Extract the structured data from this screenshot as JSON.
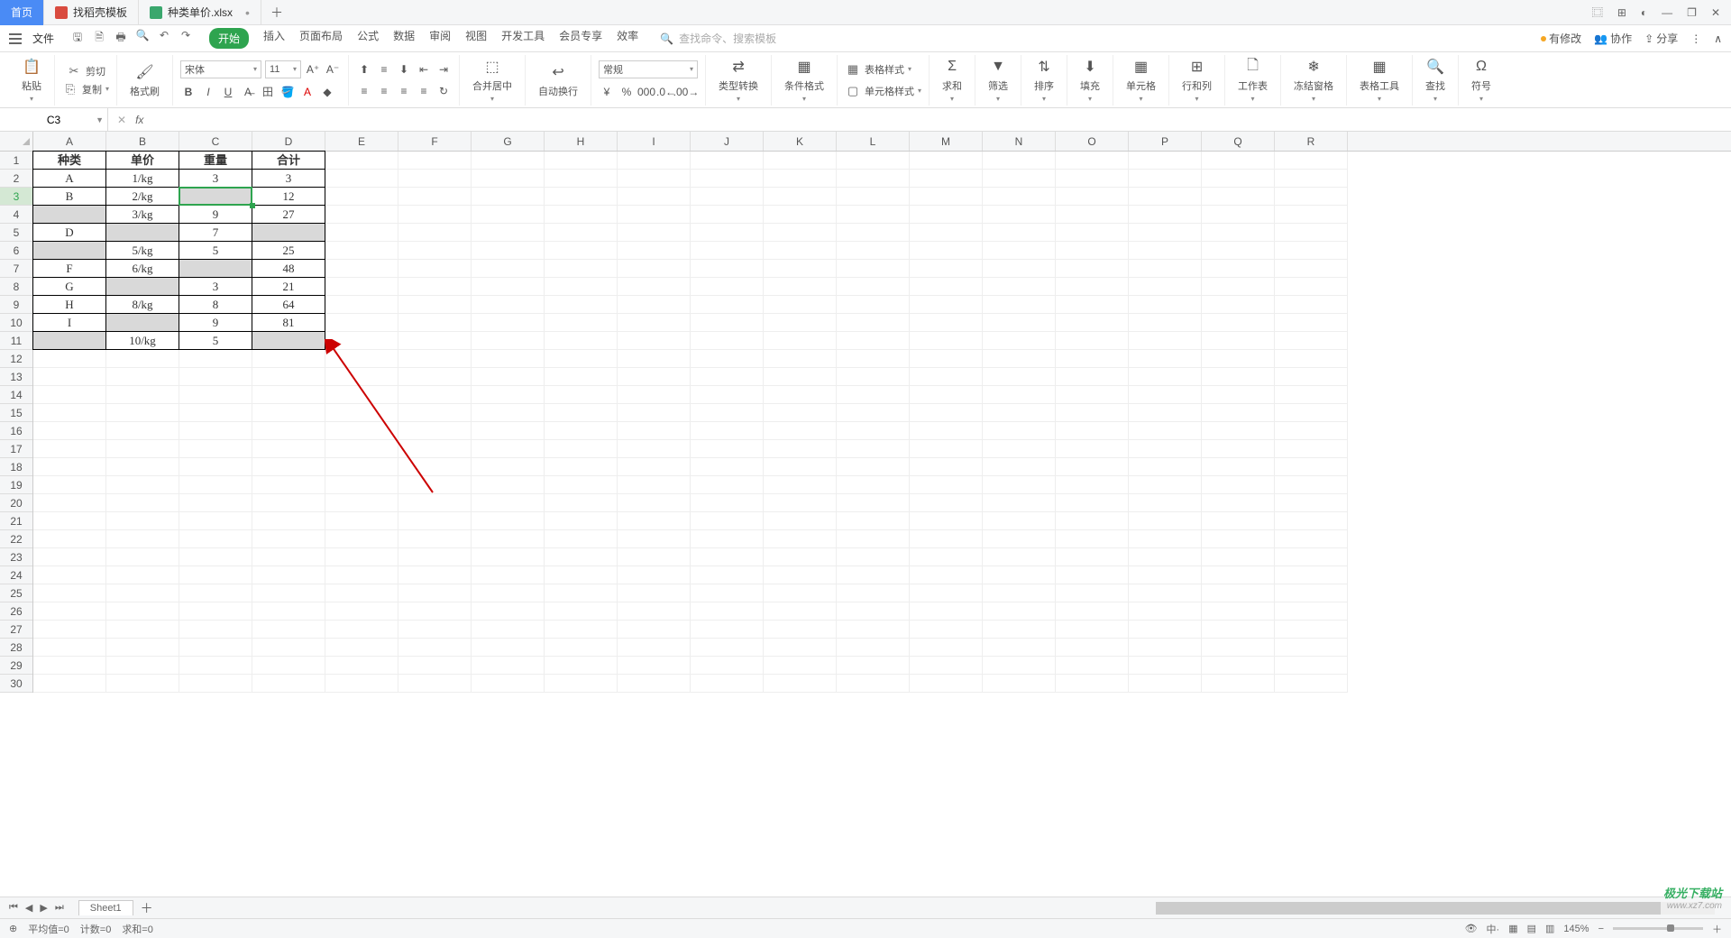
{
  "title_tabs": {
    "home": "首页",
    "template": "找稻壳模板",
    "file": "种类单价.xlsx"
  },
  "menu": {
    "file": "文件",
    "tabs": [
      "开始",
      "插入",
      "页面布局",
      "公式",
      "数据",
      "审阅",
      "视图",
      "开发工具",
      "会员专享",
      "效率"
    ],
    "search_placeholder": "查找命令、搜索模板",
    "right": {
      "unsaved": "有修改",
      "coop": "协作",
      "share": "分享"
    }
  },
  "ribbon": {
    "paste": "粘贴",
    "cut": "剪切",
    "copy": "复制",
    "format_painter": "格式刷",
    "font_name": "宋体",
    "font_size": "11",
    "merge": "合并居中",
    "wrap": "自动换行",
    "number_format": "常规",
    "type_convert": "类型转换",
    "cond_format": "条件格式",
    "table_style": "表格样式",
    "cell_style": "单元格样式",
    "sum": "求和",
    "filter": "筛选",
    "sort": "排序",
    "fill": "填充",
    "cells": "单元格",
    "rowcol": "行和列",
    "sheet": "工作表",
    "freeze": "冻结窗格",
    "table_tools": "表格工具",
    "find": "查找",
    "symbol": "符号"
  },
  "namebox": "C3",
  "columns": [
    "A",
    "B",
    "C",
    "D",
    "E",
    "F",
    "G",
    "H",
    "I",
    "J",
    "K",
    "L",
    "M",
    "N",
    "O",
    "P",
    "Q",
    "R"
  ],
  "row_count": 30,
  "selected_row": 3,
  "table": {
    "headers": [
      "种类",
      "单价",
      "重量",
      "合计"
    ],
    "rows": [
      {
        "a": "A",
        "b": "1/kg",
        "c": "3",
        "d": "3",
        "gray": []
      },
      {
        "a": "B",
        "b": "2/kg",
        "c": "",
        "d": "12",
        "gray": [
          "c"
        ]
      },
      {
        "a": "",
        "b": "3/kg",
        "c": "9",
        "d": "27",
        "gray": [
          "a"
        ]
      },
      {
        "a": "D",
        "b": "",
        "c": "7",
        "d": "",
        "gray": [
          "b",
          "d"
        ]
      },
      {
        "a": "",
        "b": "5/kg",
        "c": "5",
        "d": "25",
        "gray": [
          "a"
        ]
      },
      {
        "a": "F",
        "b": "6/kg",
        "c": "",
        "d": "48",
        "gray": [
          "c"
        ]
      },
      {
        "a": "G",
        "b": "",
        "c": "3",
        "d": "21",
        "gray": [
          "b"
        ]
      },
      {
        "a": "H",
        "b": "8/kg",
        "c": "8",
        "d": "64",
        "gray": []
      },
      {
        "a": "I",
        "b": "",
        "c": "9",
        "d": "81",
        "gray": [
          "b"
        ]
      },
      {
        "a": "",
        "b": "10/kg",
        "c": "5",
        "d": "",
        "gray": [
          "a",
          "d"
        ]
      }
    ]
  },
  "sheet": {
    "name": "Sheet1"
  },
  "status": {
    "avg": "平均值=0",
    "count": "计数=0",
    "sum": "求和=0",
    "zoom": "145%"
  },
  "watermark": {
    "brand": "极光下载站",
    "site": "www.xz7.com"
  }
}
